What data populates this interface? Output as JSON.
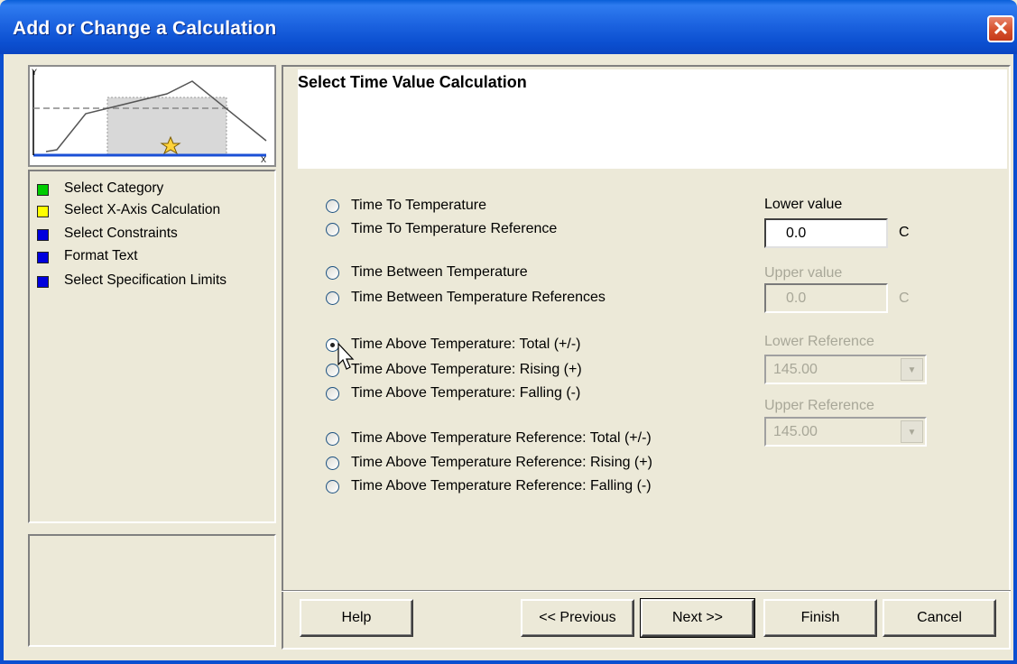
{
  "window": {
    "title": "Add or Change a Calculation",
    "close_glyph": "✕"
  },
  "thumbnail": {
    "y_label": "Y",
    "x_label": "X",
    "icon": "star-icon"
  },
  "steps": [
    {
      "label": "Select Category",
      "color": "#00cc00"
    },
    {
      "label": "Select X-Axis Calculation",
      "color": "#ffff00"
    },
    {
      "label": "Select Constraints",
      "color": "#0000dd"
    },
    {
      "label": "Format Text",
      "color": "#0000dd"
    },
    {
      "label": "Select Specification Limits",
      "color": "#0000dd"
    }
  ],
  "header": {
    "title": "Select Time Value Calculation"
  },
  "options": [
    {
      "label": "Time To Temperature",
      "selected": false
    },
    {
      "label": "Time To Temperature Reference",
      "selected": false
    },
    {
      "label": "Time Between Temperature",
      "selected": false
    },
    {
      "label": "Time Between Temperature References",
      "selected": false
    },
    {
      "label": "Time Above Temperature: Total (+/-)",
      "selected": true
    },
    {
      "label": "Time Above Temperature: Rising (+)",
      "selected": false
    },
    {
      "label": "Time Above Temperature: Falling (-)",
      "selected": false
    },
    {
      "label": "Time Above Temperature Reference: Total (+/-)",
      "selected": false
    },
    {
      "label": "Time Above Temperature Reference: Rising (+)",
      "selected": false
    },
    {
      "label": "Time Above Temperature Reference: Falling (-)",
      "selected": false
    }
  ],
  "fields": {
    "lower_value": {
      "label": "Lower value",
      "value": "0.0",
      "unit": "C"
    },
    "upper_value": {
      "label": "Upper value",
      "value": "0.0",
      "unit": "C"
    },
    "lower_reference": {
      "label": "Lower Reference",
      "value": "145.00"
    },
    "upper_reference": {
      "label": "Upper Reference",
      "value": "145.00"
    }
  },
  "buttons": {
    "help": "Help",
    "previous": "<< Previous",
    "next": "Next >>",
    "finish": "Finish",
    "cancel": "Cancel"
  }
}
